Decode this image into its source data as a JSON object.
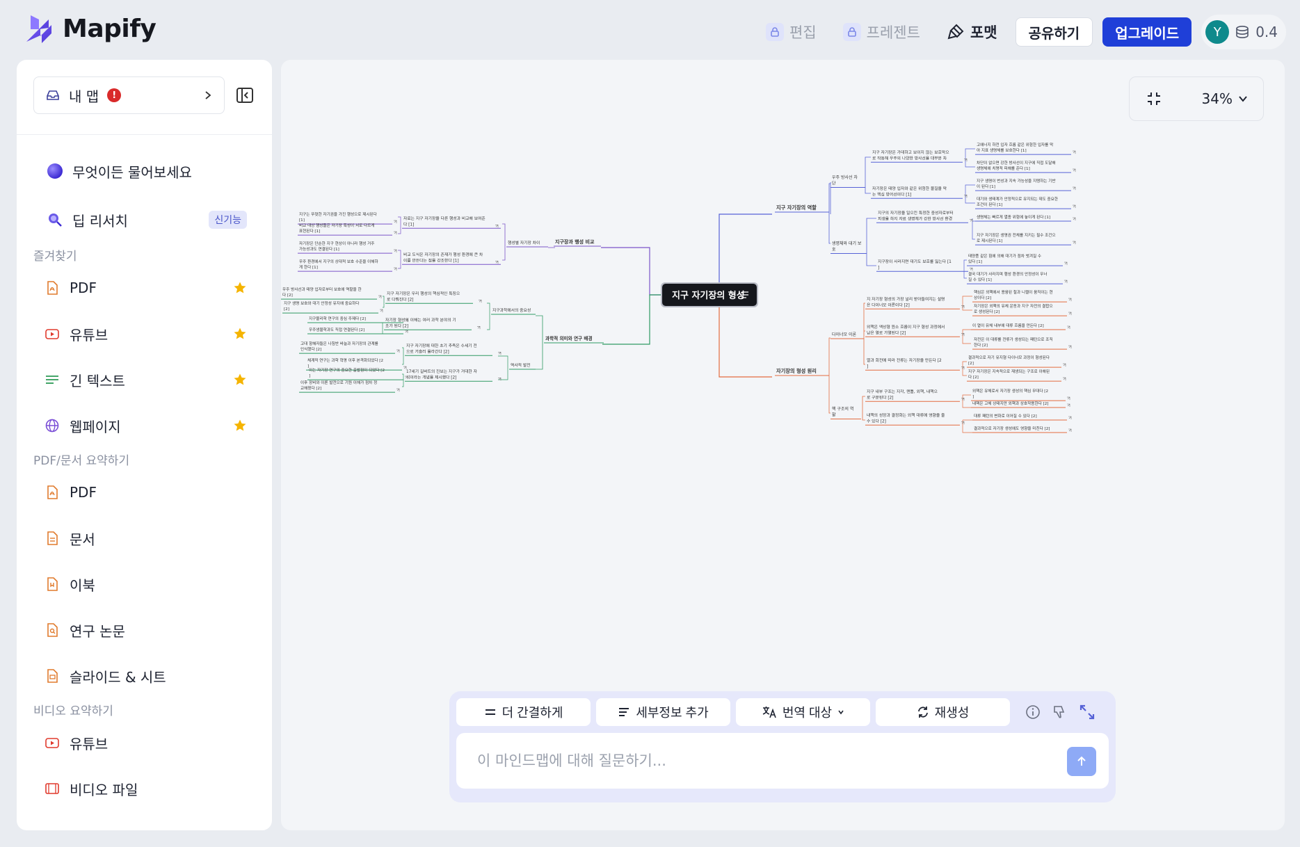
{
  "app": {
    "name": "Mapify"
  },
  "topbar": {
    "edit_label": "편집",
    "present_label": "프레젠트",
    "format_label": "포맷",
    "share_label": "공유하기",
    "upgrade_label": "업그레이드",
    "avatar_initial": "Y",
    "credits": "0.4"
  },
  "sidebar": {
    "my_map_label": "내 맵",
    "alert_mark": "!",
    "ask_label": "무엇이든 물어보세요",
    "deep_research_label": "딥 리서치",
    "new_badge": "신기능",
    "sections": {
      "favorites": "즐겨찾기",
      "pdf_doc": "PDF/문서 요약하기",
      "video": "비디오 요약하기"
    },
    "favorites": [
      {
        "label": "PDF",
        "icon": "pdf-icon",
        "color": "#e07a2c"
      },
      {
        "label": "유튜브",
        "icon": "youtube-icon",
        "color": "#e0392c"
      },
      {
        "label": "긴 텍스트",
        "icon": "long-text-icon",
        "color": "#2c9a55"
      },
      {
        "label": "웹페이지",
        "icon": "globe-icon",
        "color": "#7a4ed6"
      }
    ],
    "doc_items": [
      {
        "label": "PDF"
      },
      {
        "label": "문서"
      },
      {
        "label": "이북"
      },
      {
        "label": "연구 논문"
      },
      {
        "label": "슬라이드 & 시트"
      }
    ],
    "video_items": [
      {
        "label": "유튜브"
      },
      {
        "label": "비디오 파일"
      }
    ]
  },
  "canvas": {
    "zoom": "34%"
  },
  "mindmap": {
    "root": "지구 자기장의 형성",
    "branches": {
      "roles": {
        "title": "지구 자기장의 역할",
        "color": "#5561d6",
        "subs": [
          {
            "label": "우주 방사선 차단"
          },
          {
            "label": "생명체와 대기 보호"
          }
        ],
        "details": [
          "지구 자기장은 가데하고 보이지 않는 보호막으로 작동해 우주의 나양한 방사선을 대부분 차단한다 [1]",
          "자기장은 태양 입자와 같은 위험한 물질을 막는 핵심 방어선이다 [1]",
          "지구의 자기장을 일으킨 특정한 중성자로부터 피생을 하지 자료 생명체가 강한 방사선 환경에서 살아남기 어려웠다 [1]",
          "지구장이 사라지면 대기도 보호를 잃는다 [1]"
        ],
        "leaves": [
          "고에너지 하전 입자 흐름 같은 위험한 입자를 막아 지표 생명체를 보호한다 [1]",
          "차단이 없으면 강한 방사선이 지구에 직접 도달해 생명체에 치명적 피해를 준다 [1]",
          "지구 생명이 번성과 지속 가능성을 지탱하는 기반이 된다 [1]",
          "대기와 생태계가 안정적으로 유지되는 데도 중요한 조건이 된다 [1]",
          "생명체는 빠르게 멸종 위험에 놓이게 된다 [1]",
          "지구 자기장은 생명권 전체를 지키는 필수 조건으로 제시된다 [1]",
          "태양풍 같은 힘에 의해 대기가 점차 벗겨질 수 있다 [1]",
          "결국 대기가 사라지며 행성 환경의 안정성이 무너질 수 있다 [1]"
        ]
      },
      "principles": {
        "title": "자기장의 형성 원리",
        "color": "#e36b3f",
        "subs": [
          {
            "label": "다이너모 이론"
          },
          {
            "label": "핵 구조의 역할"
          }
        ],
        "details": [
          "지 자기장 형성의 가장 널리 받아들여지는 설명은 다이너모 이론이다 [2]",
          "외핵은 액상형 원소 흐름이 지구 형성 과정에서 남은 열로 가열된다 [2]",
          "열과 회전에 따라 전류는 자기장을 만든다 [2]",
          "지구 내부 구조는 지각, 맨틀, 외핵, 내핵으로 구분된다 [2]",
          "내핵의 성장과 결정화는 외핵 대류에 영향을 줄 수 있다 [2]"
        ],
        "leaves": [
          "핵심은 외핵에서 용융된 철과 니켈이 움직이는 현상이다 [2]",
          "자기장은 외핵의 유체 운동과 지구 자전의 결합으로 생성된다 [2]",
          "이 열이 유체 내부에 대류 흐름을 만든다 [2]",
          "자전은 이 대류를 전류가 생성되는 패턴으로 조직한다 [2]",
          "결과적으로 자기 유지형 다이너모 과정이 형성된다 [2]",
          "지구 자기장은 지속적으로 재생되는 구조로 이해된다 [2]",
          "외핵은 유체로서 자기장 생성의 핵심 무대다 [2]",
          "내핵은 고체 상태지만 외핵과 상호작용한다 [2]",
          "대류 패턴의 변화로 이어질 수 있다 [2]",
          "결과적으로 자기장 생성에도 영향을 미친다 [2]"
        ]
      },
      "comparison": {
        "title": "지구장과 행성 비교",
        "color": "#7b55c9",
        "subs": [
          {
            "label": "행성별 자기장 차이"
          }
        ],
        "details": [
          "자료는 지구 자기장을 다른 행성과 비교해 보여준다 [1]",
          "비교 도식은 자기장의 존재가 행성 환경에 큰 차이를 만든다는 점을 강조한다 [1]"
        ],
        "leaves": [
          "지구는 뚜렷한 자기권을 가진 행성으로 제시된다 [1]",
          "비교 대상 행성들은 자기장 특성이 서로 다르게 표현된다 [1]",
          "자기장은 단순한 지구 현상이 아니라 행성 거주 가능성과도 연결된다 [1]",
          "우주 환경에서 지구의 상대적 보호 수준을 이해하게 한다 [1]"
        ]
      },
      "science": {
        "title": "과학적 의미와 연구 배경",
        "color": "#2e9a63",
        "subs": [
          {
            "label": "지구과학에서의 중요성"
          },
          {
            "label": "역사적 발전"
          }
        ],
        "details": [
          "지구 자기장은 우리 행성의 핵심적인 특징으로 다뤄진다 [2]",
          "자기장 형성의 이해는 여러 과학 분야의 기초가 된다 [2]",
          "지구 자기장에 대한 초기 추측은 수세기 전으로 거슬러 올라간다 [2]",
          "17세기 길버트의 진보는 지구가 거대한 자석이라는 개념을 제시했다 [2]"
        ],
        "leaves": [
          "우주 방사선과 태양 입자로부터 보호에 역할을 한다 [2]",
          "지구 생명 보호와 대기 안정성 유지에 중요하다 [2]",
          "지구물리학 연구의 중심 주제다 [2]",
          "우주생물학과도 직접 연결된다 [2]",
          "고대 항해자들은 나침반 바늘과 자기장의 관계를 인식했다 [2]",
          "체계적 연구는 과학 혁명 이후 본격화되었다 [2]",
          "이는 자기장 연구의 중요한 출발점이 되었다 [2]",
          "이후 장비와 이론 발전으로 기원 이해가 점차 정교해졌다 [2]"
        ]
      }
    }
  },
  "chat": {
    "concise_label": "더 간결하게",
    "details_label": "세부정보 추가",
    "translate_label": "번역 대상",
    "regenerate_label": "재생성",
    "placeholder": "이 마인드맵에 대해 질문하기..."
  }
}
